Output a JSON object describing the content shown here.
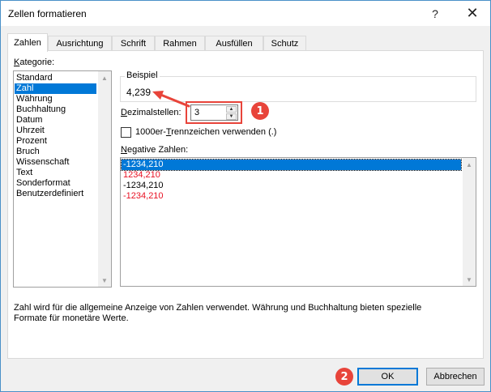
{
  "window": {
    "title": "Zellen formatieren",
    "help_glyph": "?",
    "close_glyph": "✕"
  },
  "tabs": [
    {
      "label": "Zahlen",
      "active": true
    },
    {
      "label": "Ausrichtung",
      "active": false
    },
    {
      "label": "Schrift",
      "active": false
    },
    {
      "label": "Rahmen",
      "active": false
    },
    {
      "label": "Ausfüllen",
      "active": false
    },
    {
      "label": "Schutz",
      "active": false
    }
  ],
  "category": {
    "label_underlined": "K",
    "label_rest": "ategorie:",
    "items": [
      "Standard",
      "Zahl",
      "Währung",
      "Buchhaltung",
      "Datum",
      "Uhrzeit",
      "Prozent",
      "Bruch",
      "Wissenschaft",
      "Text",
      "Sonderformat",
      "Benutzerdefiniert"
    ],
    "selected": "Zahl"
  },
  "sample": {
    "label": "Beispiel",
    "value": "4,239"
  },
  "decimals": {
    "label_underlined": "D",
    "label_rest": "ezimalstellen:",
    "value": "3"
  },
  "thousands": {
    "label_before": "1000er-",
    "label_underlined": "T",
    "label_after": "rennzeichen verwenden (.)",
    "checked": false
  },
  "negative": {
    "label_underlined": "N",
    "label_rest": "egative Zahlen:",
    "items": [
      {
        "text": "-1234,210",
        "color": "#000000",
        "selected": true
      },
      {
        "text": "1234,210",
        "color": "#e81123",
        "selected": false
      },
      {
        "text": "-1234,210",
        "color": "#000000",
        "selected": false
      },
      {
        "text": "-1234,210",
        "color": "#e81123",
        "selected": false
      }
    ]
  },
  "description": {
    "line1": "Zahl wird für die allgemeine Anzeige von Zahlen verwendet. Währung und Buchhaltung bieten spezielle",
    "line2": "Formate für monetäre Werte."
  },
  "buttons": {
    "ok": "OK",
    "cancel": "Abbrechen"
  },
  "annotations": {
    "badge1": "1",
    "badge2": "2",
    "accent_color": "#e8443a"
  }
}
